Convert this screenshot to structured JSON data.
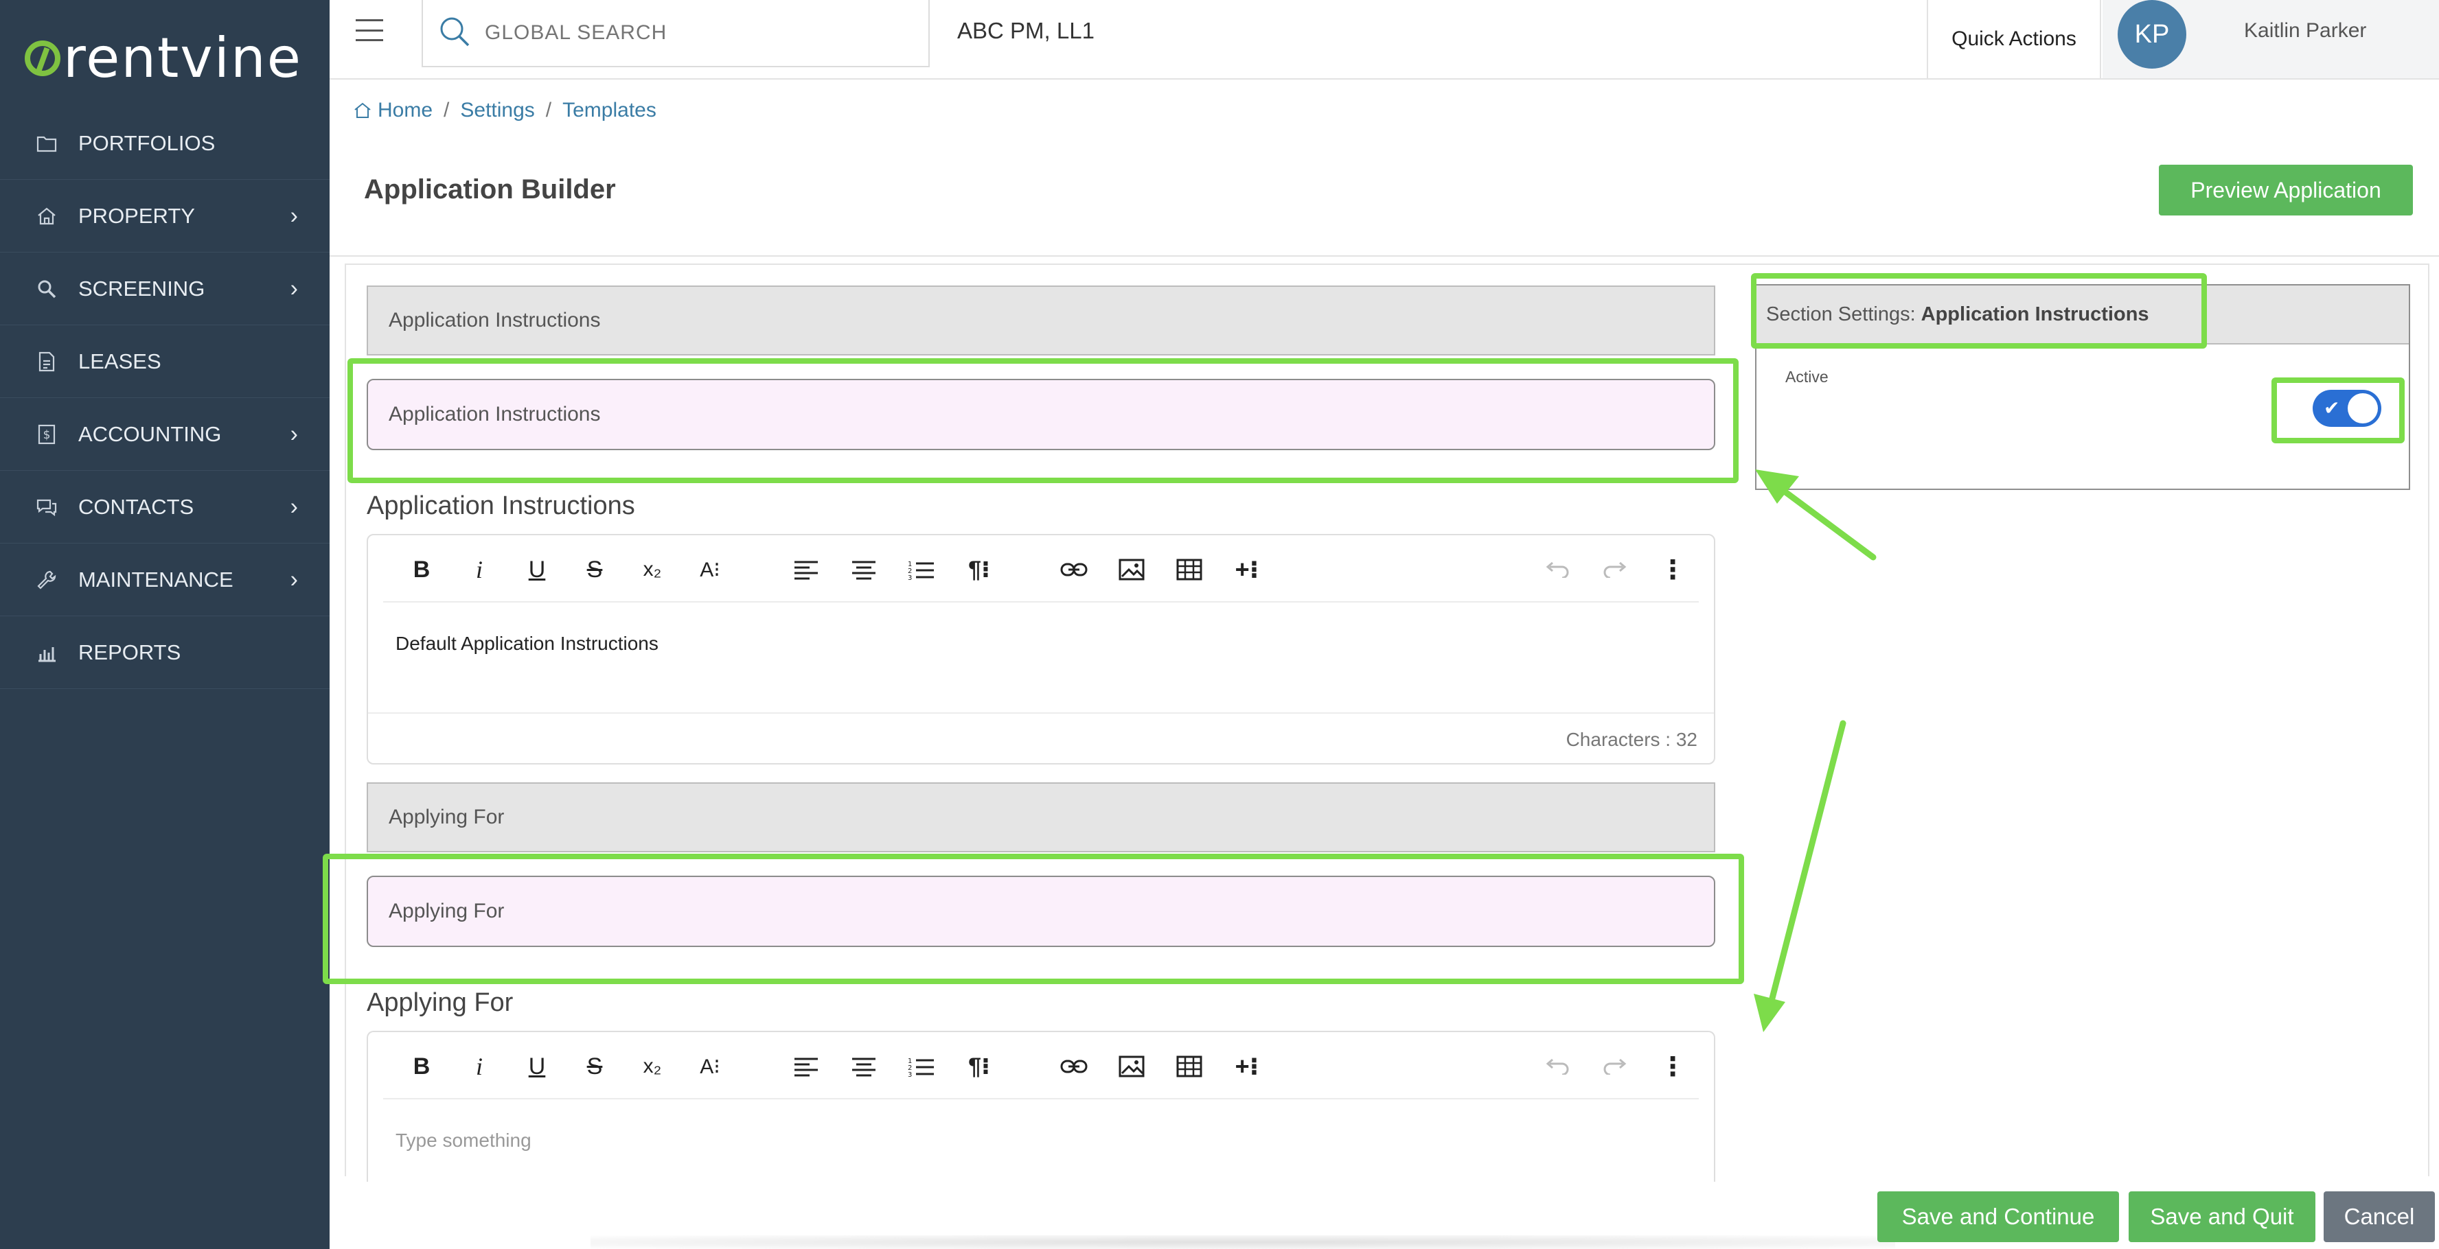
{
  "brand": {
    "logo_text": "rentvine",
    "accent": "#7fc241",
    "sidebar_bg": "#2d3e4f"
  },
  "sidebar": {
    "items": [
      {
        "label": "PORTFOLIOS",
        "icon": "folder-icon",
        "has_children": false
      },
      {
        "label": "PROPERTY",
        "icon": "home-icon",
        "has_children": true
      },
      {
        "label": "SCREENING",
        "icon": "magnifier-icon",
        "has_children": true
      },
      {
        "label": "LEASES",
        "icon": "document-icon",
        "has_children": false
      },
      {
        "label": "ACCOUNTING",
        "icon": "dollar-icon",
        "has_children": true
      },
      {
        "label": "CONTACTS",
        "icon": "chat-icon",
        "has_children": true
      },
      {
        "label": "MAINTENANCE",
        "icon": "wrench-icon",
        "has_children": true
      },
      {
        "label": "REPORTS",
        "icon": "bar-chart-icon",
        "has_children": false
      }
    ]
  },
  "topbar": {
    "search_placeholder": "GLOBAL SEARCH",
    "company": "ABC PM, LL1",
    "quick_actions": "Quick Actions",
    "user_initials": "KP",
    "user_name": "Kaitlin Parker"
  },
  "breadcrumb": {
    "home": "Home",
    "settings": "Settings",
    "templates": "Templates"
  },
  "page": {
    "title": "Application Builder",
    "preview_button": "Preview Application"
  },
  "sections": [
    {
      "header": "Application Instructions",
      "name_value": "Application Instructions",
      "editor_label": "Application Instructions",
      "editor_content": "Default Application Instructions",
      "char_count": "Characters : 32"
    },
    {
      "header": "Applying For",
      "name_value": "Applying For",
      "editor_label": "Applying For",
      "editor_placeholder": "Type something"
    }
  ],
  "settings": {
    "header_prefix": "Section Settings:",
    "header_section": "Application Instructions",
    "active_label": "Active",
    "active": true
  },
  "footer": {
    "save_continue": "Save and Continue",
    "save_quit": "Save and Quit",
    "cancel": "Cancel"
  },
  "colors": {
    "green_button": "#5cb85c",
    "highlight": "#7ddc4a",
    "toggle_on": "#2a6fd4",
    "link": "#3a7ca5"
  }
}
